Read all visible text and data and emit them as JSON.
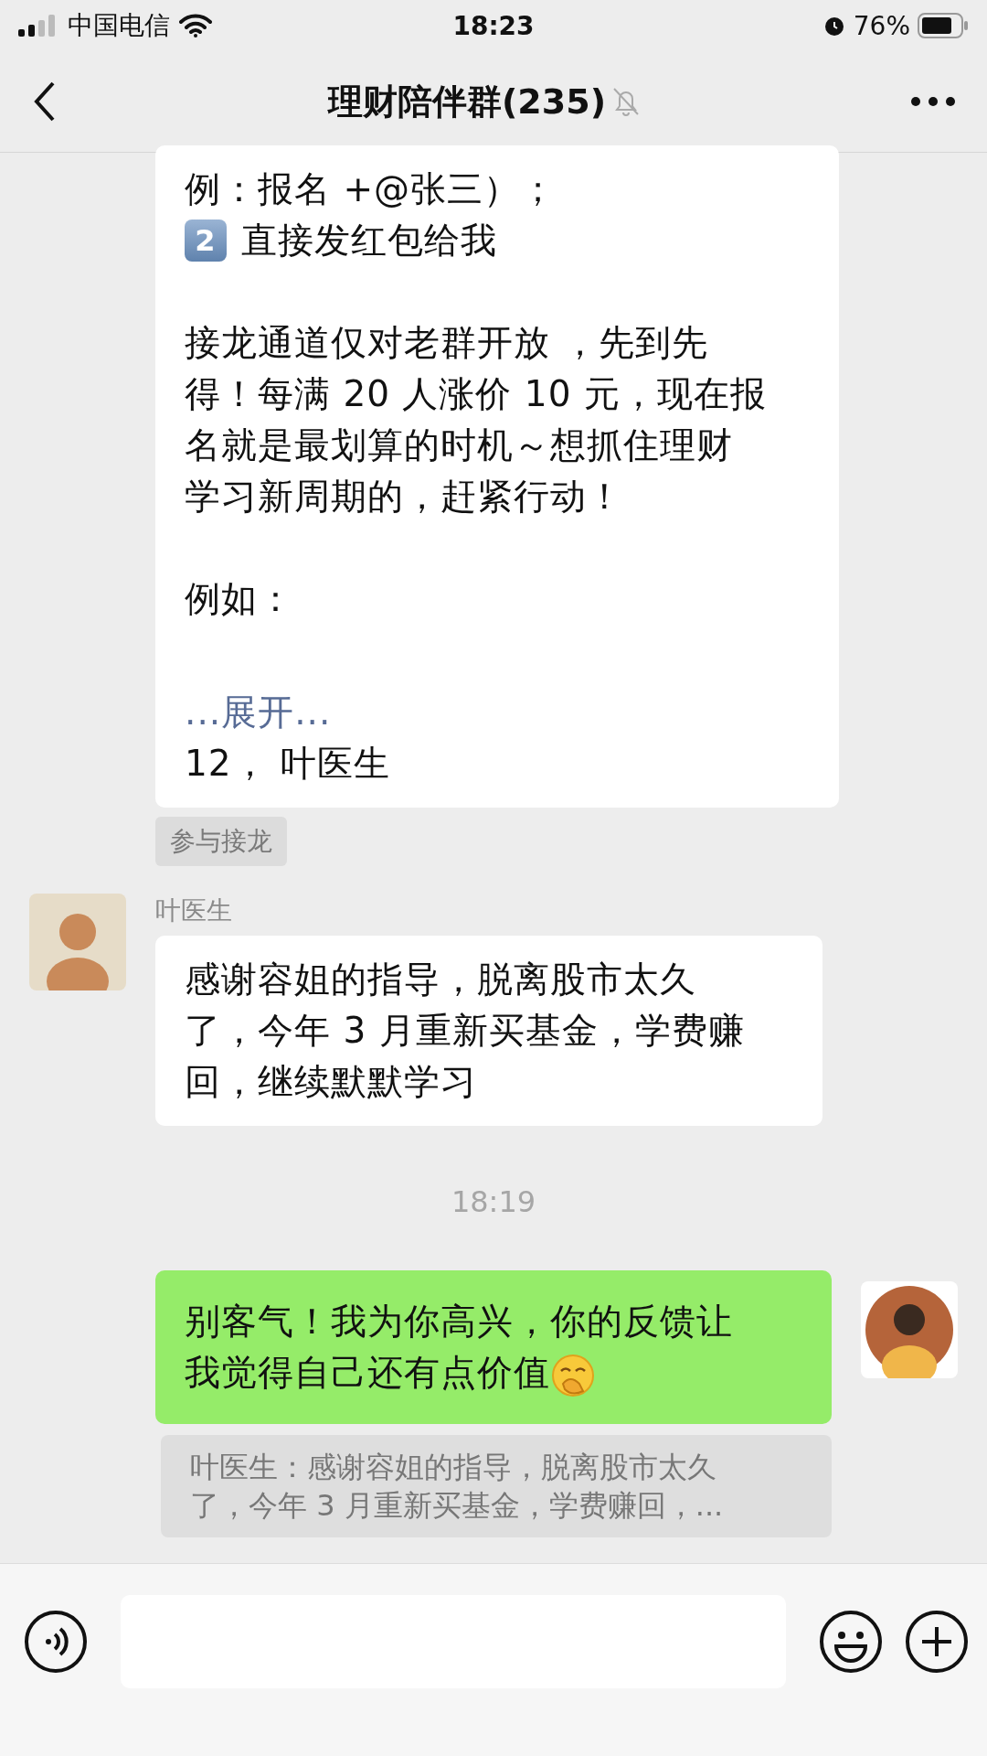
{
  "status_bar": {
    "carrier": "中国电信",
    "time": "18:23",
    "battery": "76%"
  },
  "header": {
    "title": "理财陪伴群(235)",
    "muted": true
  },
  "messages": [
    {
      "kind": "solitaire",
      "blocks": [
        {
          "kind": "line",
          "text": "例：报名 +@张三）；"
        },
        {
          "kind": "keycap",
          "number": "2",
          "text": "直接发红包给我"
        },
        {
          "kind": "paragraph",
          "lines": [
            "接龙通道仅对老群开放 ，先到先",
            "得！每满 20 人涨价 10 元，现在报",
            "名就是最划算的时机～想抓住理财",
            "学习新周期的，赶紧行动！"
          ]
        },
        {
          "kind": "paragraph",
          "lines": [
            "例如："
          ]
        },
        {
          "kind": "link",
          "text": "...展开..."
        },
        {
          "kind": "line",
          "text": "12， 叶医生"
        }
      ],
      "action": "参与接龙"
    },
    {
      "kind": "received",
      "sender": "叶医生",
      "lines": [
        "感谢容姐的指导，脱离股市太久",
        "了，今年 3 月重新买基金，学费赚",
        "回，继续默默学习"
      ]
    },
    {
      "kind": "time",
      "text": "18:19"
    },
    {
      "kind": "sent",
      "lines": [
        "别客气！我为你高兴，你的反馈让",
        "我觉得自己还有点价值"
      ],
      "trailing_emoji": true,
      "quote": {
        "lines": [
          "叶医生：感谢容姐的指导，脱离股市太久",
          "了，今年 3 月重新买基金，学费赚回，..."
        ]
      }
    }
  ]
}
